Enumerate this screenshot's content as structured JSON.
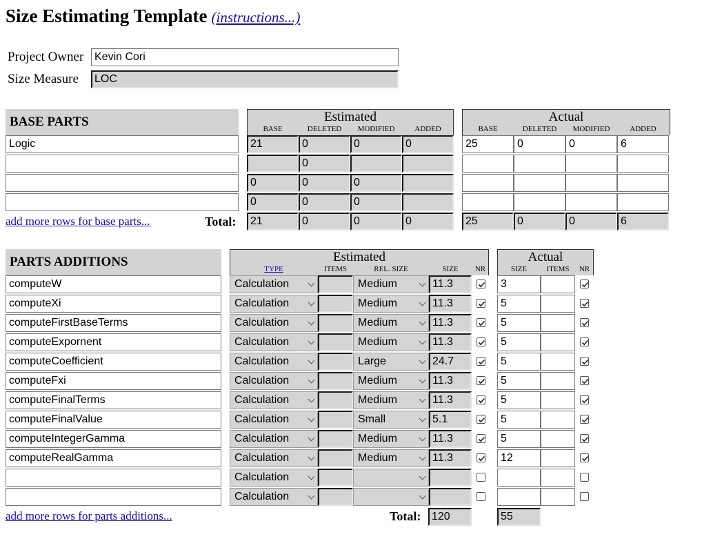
{
  "title": "Size Estimating Template",
  "instructions_link": "(instructions...)",
  "project_owner": {
    "label": "Project Owner",
    "value": "Kevin Cori"
  },
  "size_measure": {
    "label": "Size Measure",
    "value": "LOC"
  },
  "base_parts": {
    "heading": "BASE PARTS",
    "estimated_title": "Estimated",
    "actual_title": "Actual",
    "columns": [
      "BASE",
      "DELETED",
      "MODIFIED",
      "ADDED"
    ],
    "rows": [
      {
        "name": "Logic",
        "est": [
          "21",
          "0",
          "0",
          "0"
        ],
        "act": [
          "25",
          "0",
          "0",
          "6"
        ]
      },
      {
        "name": "",
        "est": [
          "",
          "0",
          "",
          ""
        ],
        "act": [
          "",
          "",
          "",
          ""
        ]
      },
      {
        "name": "",
        "est": [
          "0",
          "0",
          "0",
          ""
        ],
        "act": [
          "",
          "",
          "",
          ""
        ]
      },
      {
        "name": "",
        "est": [
          "0",
          "0",
          "0",
          ""
        ],
        "act": [
          "",
          "",
          "",
          ""
        ]
      }
    ],
    "add_rows_link": "add more rows for base parts...",
    "total_label": "Total:",
    "total_est": [
      "21",
      "0",
      "0",
      "0"
    ],
    "total_act": [
      "25",
      "0",
      "0",
      "6"
    ]
  },
  "parts_additions": {
    "heading": "PARTS ADDITIONS",
    "estimated_title": "Estimated",
    "actual_title": "Actual",
    "est_columns": [
      "TYPE",
      "ITEMS",
      "REL. SIZE",
      "SIZE",
      "NR"
    ],
    "act_columns": [
      "SIZE",
      "ITEMS",
      "NR"
    ],
    "rows": [
      {
        "name": "computeW",
        "type": "Calculation",
        "items": "",
        "rel_size": "Medium",
        "size": "11.3",
        "nr": true,
        "act_size": "3",
        "act_items": "",
        "act_nr": true
      },
      {
        "name": "computeXi",
        "type": "Calculation",
        "items": "",
        "rel_size": "Medium",
        "size": "11.3",
        "nr": true,
        "act_size": "5",
        "act_items": "",
        "act_nr": true
      },
      {
        "name": "computeFirstBaseTerms",
        "type": "Calculation",
        "items": "",
        "rel_size": "Medium",
        "size": "11.3",
        "nr": true,
        "act_size": "5",
        "act_items": "",
        "act_nr": true
      },
      {
        "name": "computeExpornent",
        "type": "Calculation",
        "items": "",
        "rel_size": "Medium",
        "size": "11.3",
        "nr": true,
        "act_size": "5",
        "act_items": "",
        "act_nr": true
      },
      {
        "name": "computeCoefficient",
        "type": "Calculation",
        "items": "",
        "rel_size": "Large",
        "size": "24.7",
        "nr": true,
        "act_size": "5",
        "act_items": "",
        "act_nr": true
      },
      {
        "name": "computeFxi",
        "type": "Calculation",
        "items": "",
        "rel_size": "Medium",
        "size": "11.3",
        "nr": true,
        "act_size": "5",
        "act_items": "",
        "act_nr": true
      },
      {
        "name": "computeFinalTerms",
        "type": "Calculation",
        "items": "",
        "rel_size": "Medium",
        "size": "11.3",
        "nr": true,
        "act_size": "5",
        "act_items": "",
        "act_nr": true
      },
      {
        "name": "computeFinalValue",
        "type": "Calculation",
        "items": "",
        "rel_size": "Small",
        "size": "5.1",
        "nr": true,
        "act_size": "5",
        "act_items": "",
        "act_nr": true
      },
      {
        "name": "computeIntegerGamma",
        "type": "Calculation",
        "items": "",
        "rel_size": "Medium",
        "size": "11.3",
        "nr": true,
        "act_size": "5",
        "act_items": "",
        "act_nr": true
      },
      {
        "name": "computeRealGamma",
        "type": "Calculation",
        "items": "",
        "rel_size": "Medium",
        "size": "11.3",
        "nr": true,
        "act_size": "12",
        "act_items": "",
        "act_nr": true
      },
      {
        "name": "",
        "type": "Calculation",
        "items": "",
        "rel_size": "",
        "size": "",
        "nr": false,
        "act_size": "",
        "act_items": "",
        "act_nr": false
      },
      {
        "name": "",
        "type": "Calculation",
        "items": "",
        "rel_size": "",
        "size": "",
        "nr": false,
        "act_size": "",
        "act_items": "",
        "act_nr": false
      }
    ],
    "add_rows_link": "add more rows for parts additions...",
    "total_label": "Total:",
    "total_est_size": "120",
    "total_act_size": "55"
  },
  "colors": {
    "link": "#1a0dab",
    "header_bg": "#d3d3d3",
    "readonly_bg": "#d4d4d4"
  }
}
